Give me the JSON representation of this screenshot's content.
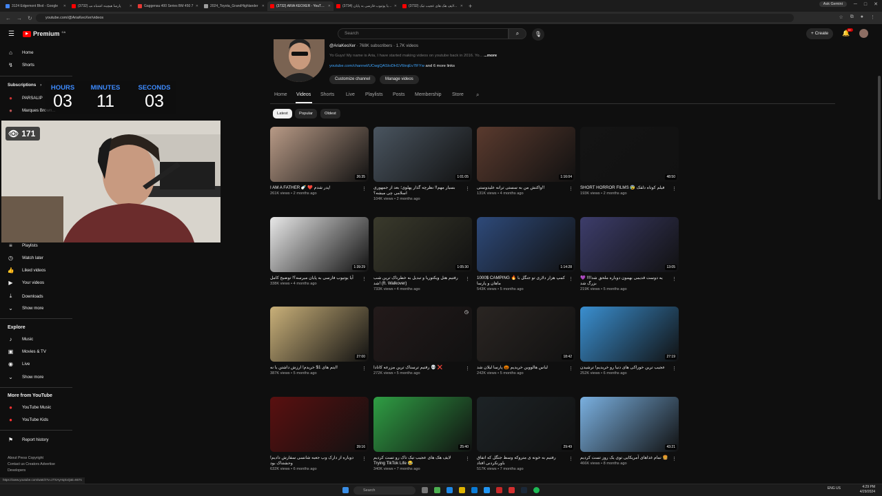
{
  "browser": {
    "tabs": [
      {
        "label": "3124 Edgemont Blvd - Google",
        "color": "#4285f4",
        "active": false
      },
      {
        "label": "(3732) پارسا هیچینه اشتباه میـ",
        "color": "#ff0000",
        "active": false
      },
      {
        "label": "Gaggenau 400 Series BM 450 7",
        "color": "#e53935",
        "active": false
      },
      {
        "label": "2024_Toyota_GrandHighlander",
        "color": "#9e9e9e",
        "active": false
      },
      {
        "label": "(3732) ARIA KEOXER - YouTube",
        "color": "#ff0000",
        "active": true
      },
      {
        "label": "(3734) آیا یوتیوب فارسی به پایان...",
        "color": "#ff0000",
        "active": false
      },
      {
        "label": "(3732) لایف هک های عجیب تیک...",
        "color": "#ff0000",
        "active": false
      }
    ],
    "new_tab": "+",
    "ask_gemini": "Ask Gemini",
    "url": "youtube.com/@AriaKeoXer/videos",
    "status_url": "https://www.youtube.com/watch?v=zTXAyHqSxQ&t=667s"
  },
  "masthead": {
    "logo": "Premium",
    "logo_cc": "CA",
    "search_placeholder": "Search",
    "create": "Create",
    "notif_count": "9+"
  },
  "sidebar": {
    "home": "Home",
    "shorts": "Shorts",
    "subscriptions": "Subscriptions",
    "subs": [
      "PARSALIP",
      "Marques Brown..."
    ],
    "playlists": "Playlists",
    "watch_later": "Watch later",
    "liked": "Liked videos",
    "your_videos": "Your videos",
    "downloads": "Downloads",
    "show_more": "Show more",
    "explore": "Explore",
    "music": "Music",
    "movies": "Movies & TV",
    "live": "Live",
    "show_more2": "Show more",
    "more_from": "More from YouTube",
    "yt_music": "YouTube Music",
    "yt_kids": "YouTube Kids",
    "report": "Report history",
    "footer1": "About  Press  Copyright",
    "footer2": "Contact us  Creators  Advertise",
    "footer3": "Developers"
  },
  "overlay": {
    "hours_label": "HOURS",
    "hours": "03",
    "minutes_label": "MINUTES",
    "minutes": "11",
    "seconds_label": "SECONDS",
    "seconds": "03",
    "viewers": "171"
  },
  "channel": {
    "handle": "@AriaKeoXer",
    "stats": "· 768K subscribers · 1.7K videos",
    "description": "Yo Guys! My name is Aria, I have started making videos on youtube back in 2016. Yo...",
    "more": "...more",
    "link": "youtube.com/channel/UCwgQASIoDH1V6trqEv7lFYw",
    "more_links": "and 6 more links",
    "customize": "Customize channel",
    "manage": "Manage videos"
  },
  "tabs": [
    "Home",
    "Videos",
    "Shorts",
    "Live",
    "Playlists",
    "Posts",
    "Membership",
    "Store"
  ],
  "chips": [
    "Latest",
    "Popular",
    "Oldest"
  ],
  "videos": [
    {
      "title": "I AM A FATHER 🍼 ❤️ پدر شدم!",
      "meta": "261K views • 2 months ago",
      "dur": "26:35",
      "bg": "#b89a86"
    },
    {
      "title": "بسیار مهم!! نظرچه گذار پهلوی؛ بعد از جمهوری اسلامی چی میشه؟",
      "meta": "104K views • 2 months ago",
      "dur": "1:01:05",
      "bg": "#4a5560"
    },
    {
      "title": "واکنش من به سستی ترانه علیدوستی!!",
      "meta": "131K views • 4 months ago",
      "dur": "1:16:04",
      "bg": "#5a3a2e"
    },
    {
      "title": "SHORT HORROR FILMS 😰 فیلم کوتاه دلقک",
      "meta": "193K views • 2 months ago",
      "dur": "48:50",
      "bg": "#141414"
    },
    {
      "title": "آیا یوتیوب فارسی به پایان میرسه؟! توضیح کامل",
      "meta": "338K views • 4 months ago",
      "dur": "1:39:29",
      "bg": "#e8e8e8"
    },
    {
      "title": "رفتیم هتل ویکتوریا و تبدیل به خطرناک ترین شب شد! (ft. Walkover)",
      "meta": "733K views • 4 months ago",
      "dur": "1:05:30",
      "bg": "#3a3a2c"
    },
    {
      "title": "1000$ CAMPING 🔥 کمپ هزار دلاری تو جنگل با ماهان و پارسا",
      "meta": "543K views • 5 months ago",
      "dur": "1:14:28",
      "bg": "#2e4a7a"
    },
    {
      "title": "یه دوست قدیمی بهمون دوباره ملحق شد!!!! 💜 بزرگ شد",
      "meta": "219K views • 5 months ago",
      "dur": "13:05",
      "bg": "#3d3d6b"
    },
    {
      "title": "ایتم های 1$ خریدم! ارزش داشتن یا نه!",
      "meta": "387K views • 5 months ago",
      "dur": "27:00",
      "bg": "#c9b079"
    },
    {
      "title": "رفتیم ترسناک ترین مزرعه کانادا 💀 ❌",
      "meta": "272K views • 5 months ago",
      "dur": "",
      "bg": "#231a1a"
    },
    {
      "title": "لباس هالووین خریدیم 🎃 پارسا لیلان شد",
      "meta": "242K views • 5 months ago",
      "dur": "18:42",
      "bg": "#2a2522"
    },
    {
      "title": "عجیب ترین خوراکی های دنیا رو خریدیم! ترشیدن",
      "meta": "252K views • 6 months ago",
      "dur": "27:19",
      "bg": "#3a8fd0"
    },
    {
      "title": "دوباره از دارک وب جعبه شانسی سفارش دادیم! وحشتناک بود",
      "meta": "632K views • 6 months ago",
      "dur": "39:16",
      "bg": "#5a1010"
    },
    {
      "title": "لایف هک های عجیب تیک تاک رو تست کردیم Trying TikTok Life 😂",
      "meta": "340K views • 7 months ago",
      "dur": "25:40",
      "bg": "#2f9e44"
    },
    {
      "title": "رفتیم به خونه ی متروکه وسط جنگل که اتفاق باورنکردنی افتاد",
      "meta": "517K views • 7 months ago",
      "dur": "29:49",
      "bg": "#1d2326"
    },
    {
      "title": "تمام غذاهای آمریکایی توی یک روز تست کردیم 🍔",
      "meta": "466K views • 8 months ago",
      "dur": "43:21",
      "bg": "#7ab0e0"
    }
  ],
  "taskbar": {
    "search": "Search",
    "lang": "ENG US",
    "time": "4:29 PM",
    "date": "4/29/2024"
  }
}
